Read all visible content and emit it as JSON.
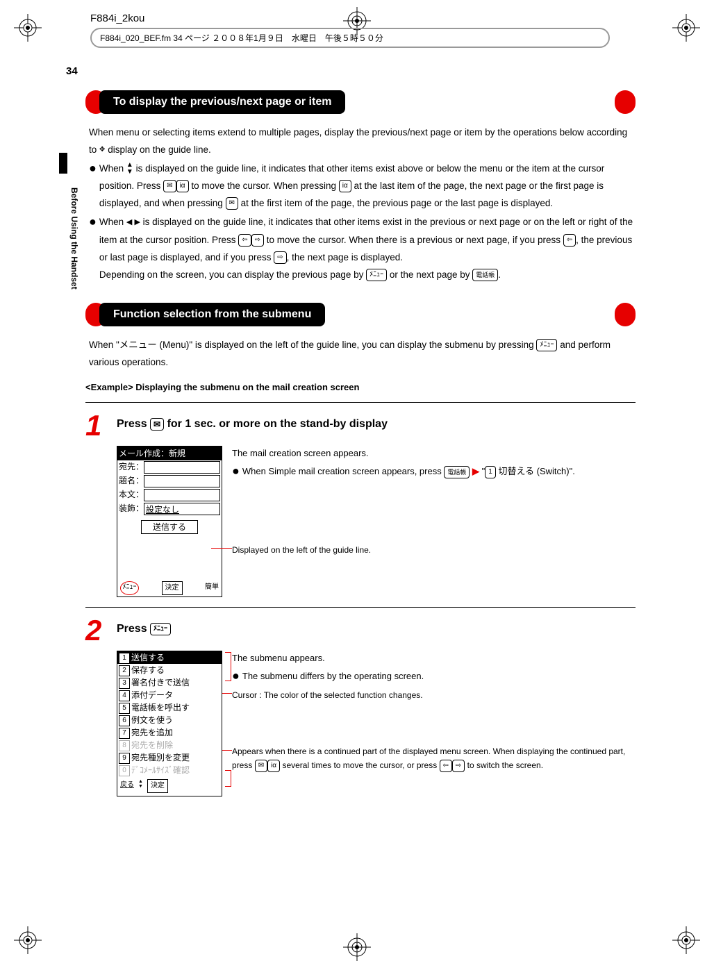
{
  "header": {
    "model": "F884i_2kou",
    "fm_line": "F884i_020_BEF.fm  34 ページ   ２００８年1月９日　水曜日　午後５時５０分"
  },
  "page_number": "34",
  "side_text": "Before Using the Handset",
  "section1": {
    "title": "To display the previous/next page or item",
    "intro": "When menu or selecting items extend to multiple pages, display the previous/next page or item by the operations below according to",
    "intro_end": "display on the guide line.",
    "bullet1_a": "When",
    "bullet1_b": "is displayed on the guide line, it indicates that other items exist above or below the menu or the item at the cursor position. Press",
    "bullet1_c": "to move the cursor. When pressing",
    "bullet1_d": "at the last item of the page, the next page or the first page is displayed, and when pressing",
    "bullet1_e": "at the first item of the page, the previous page or the last page is displayed.",
    "bullet2_a": "When",
    "bullet2_b": "is displayed on the guide line, it indicates that other items exist in the previous or next page or on the left or right of the item at the cursor position. Press",
    "bullet2_c": "to move the cursor. When there is a previous or next page, if you press",
    "bullet2_d": ", the previous or last page is displayed, and if you press",
    "bullet2_e": ", the next page is displayed.",
    "bullet2_f": "Depending on the screen, you can display the previous page by",
    "bullet2_g": "or the next page by",
    "bullet2_h": "."
  },
  "section2": {
    "title": "Function selection from the submenu",
    "intro_a": "When \"メニュー (Menu)\" is displayed on the left of the guide line, you can display the submenu by pressing",
    "intro_b": "and perform various operations.",
    "example": "<Example> Displaying the submenu on the mail creation screen"
  },
  "step1": {
    "num": "1",
    "title_a": "Press",
    "title_b": "for 1 sec. or more on the stand-by display",
    "screen": {
      "title": "メール作成：新規",
      "to": "宛先：",
      "subject": "題名：",
      "body": "本文：",
      "deco": "装飾：",
      "deco_val": "設定なし",
      "send": "送信する",
      "footer_left": "ﾒﾆｭｰ",
      "footer_mid": "決定",
      "footer_right": "簡単"
    },
    "desc1": "The mail creation screen appears.",
    "desc2_a": "When Simple mail creation screen appears, press",
    "desc2_b": "切替える (Switch)\".",
    "desc2_mid": "\"",
    "key_1": "1",
    "callout": "Displayed on the left of the guide line."
  },
  "step2": {
    "num": "2",
    "title": "Press",
    "screen_items": [
      {
        "num": "1",
        "label": "送信する",
        "state": "selected"
      },
      {
        "num": "2",
        "label": "保存する",
        "state": ""
      },
      {
        "num": "3",
        "label": "署名付きで送信",
        "state": ""
      },
      {
        "num": "4",
        "label": "添付データ",
        "state": ""
      },
      {
        "num": "5",
        "label": "電話帳を呼出す",
        "state": ""
      },
      {
        "num": "6",
        "label": "例文を使う",
        "state": ""
      },
      {
        "num": "7",
        "label": "宛先を追加",
        "state": ""
      },
      {
        "num": "8",
        "label": "宛先を削除",
        "state": "disabled"
      },
      {
        "num": "9",
        "label": "宛先種別を変更",
        "state": ""
      },
      {
        "num": "0",
        "label": "ﾃﾞｺﾒｰﾙｻｲｽﾞ確認",
        "state": "disabled"
      }
    ],
    "footer_left": "戻る",
    "footer_right": "決定",
    "desc1": "The submenu appears.",
    "desc2": "The submenu differs by the operating screen.",
    "cursor_label": "Cursor : The color of the selected function changes.",
    "cont_a": "Appears when there is a continued part of the displayed menu screen. When displaying the continued part, press",
    "cont_b": "several times to move the cursor, or press",
    "cont_c": "to switch the screen."
  },
  "keys": {
    "mail_up": "✉",
    "mail_down": "iα",
    "left": "⬅",
    "right": "➡",
    "menu": "ﾒﾆｭｰ",
    "phonebook": "電話帳"
  }
}
